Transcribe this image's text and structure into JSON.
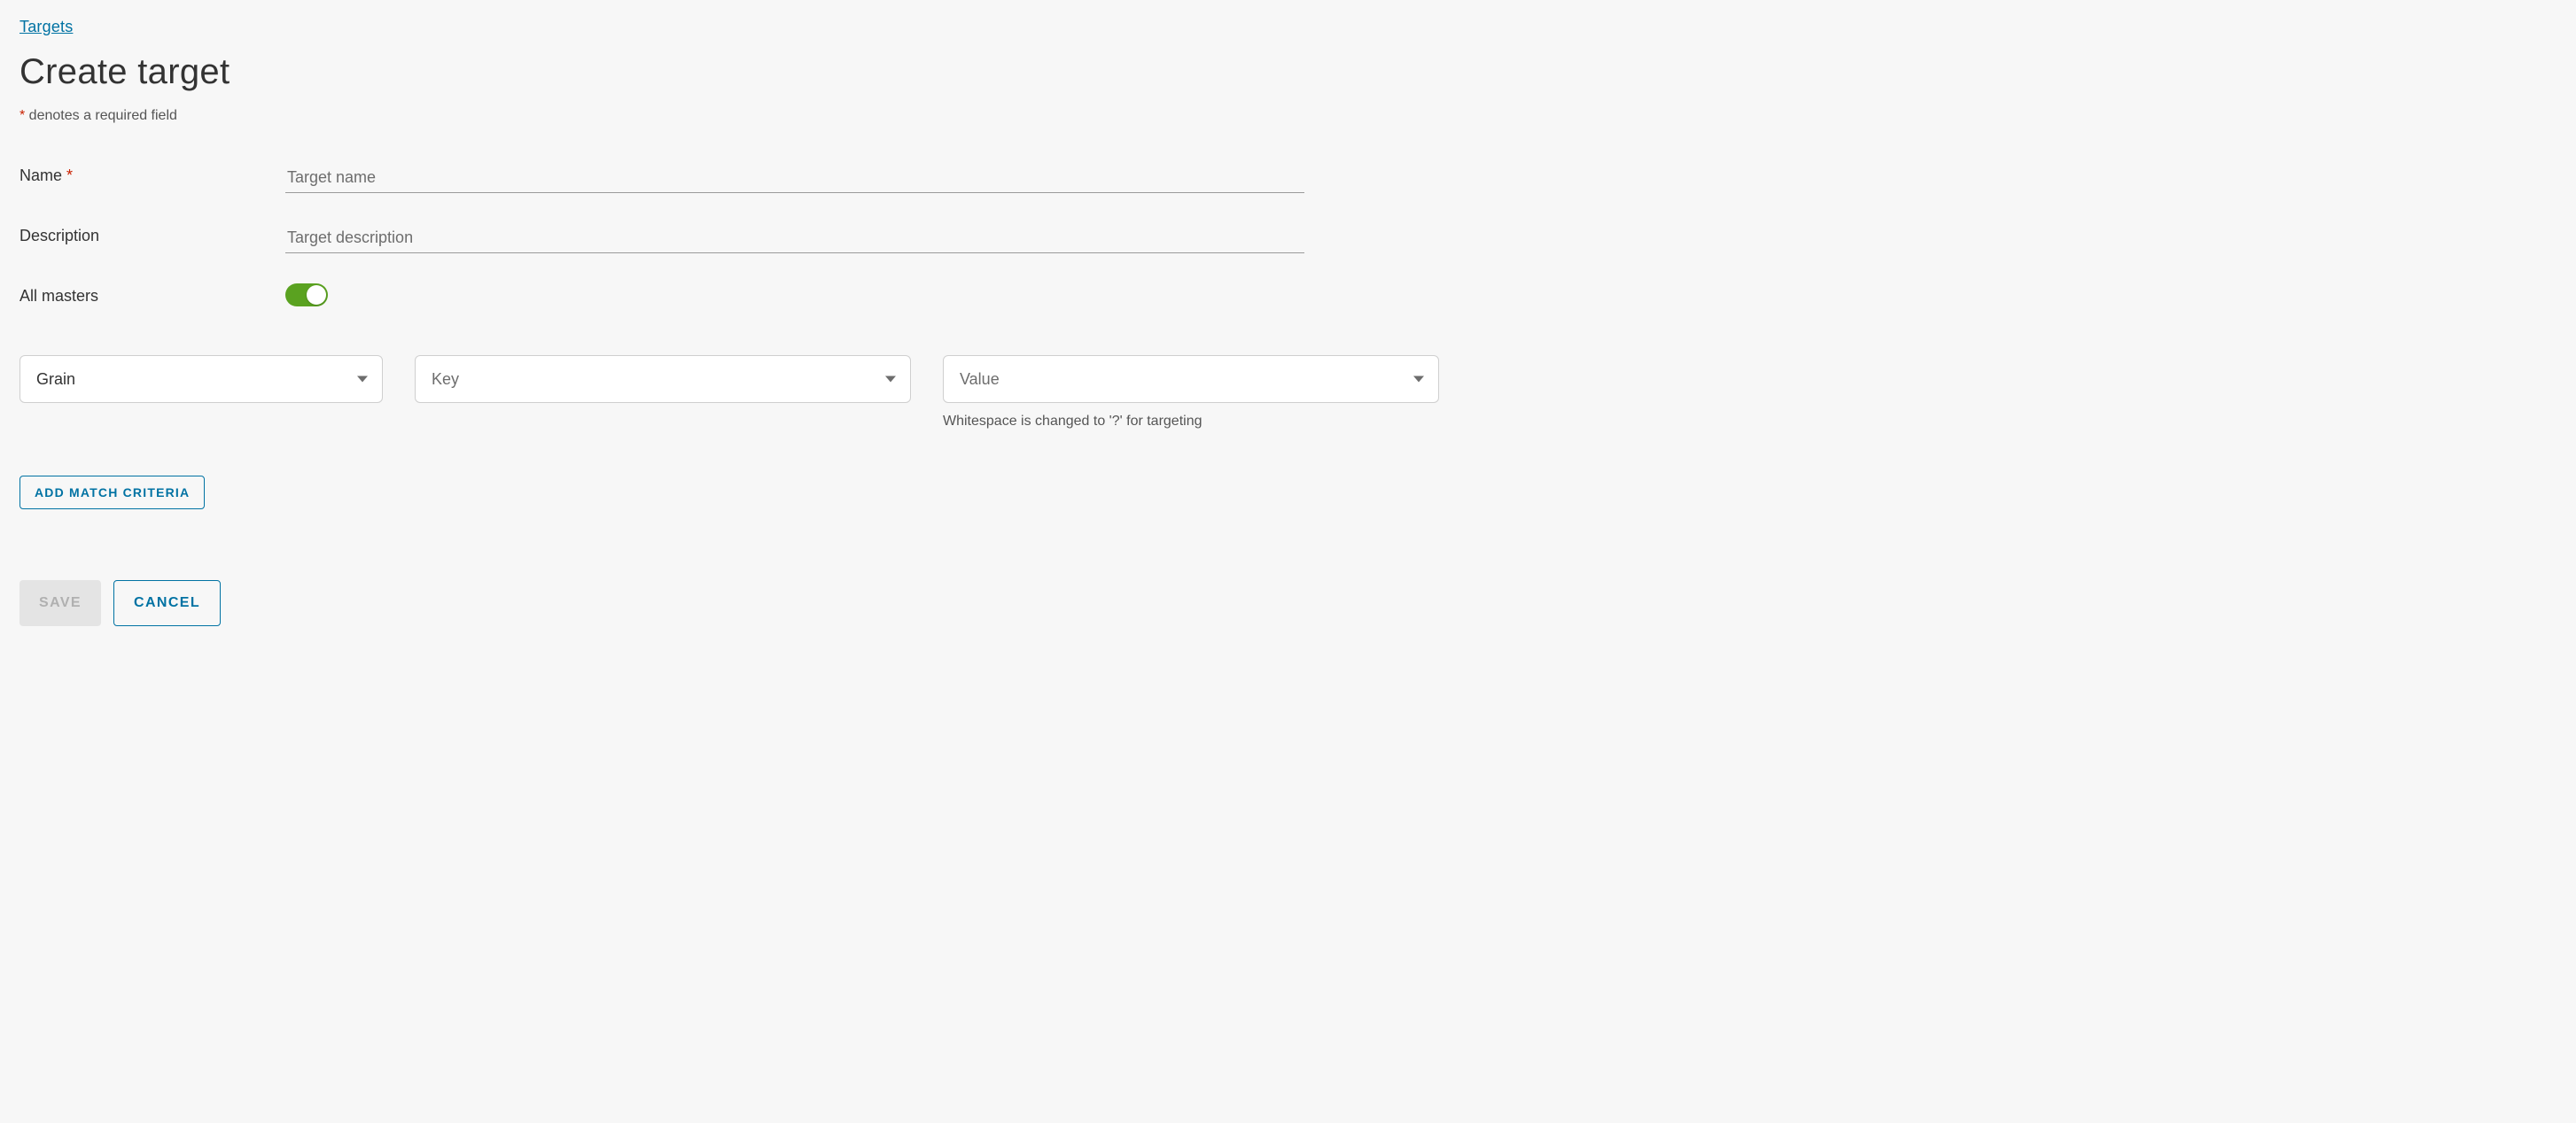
{
  "breadcrumb": {
    "targets_link": "Targets"
  },
  "page": {
    "title": "Create target",
    "required_note": " denotes a required field",
    "required_star": "*"
  },
  "form": {
    "name": {
      "label": "Name ",
      "required_mark": "*",
      "placeholder": "Target name",
      "value": ""
    },
    "description": {
      "label": "Description",
      "placeholder": "Target description",
      "value": ""
    },
    "all_masters": {
      "label": "All masters",
      "enabled": true
    }
  },
  "criteria": {
    "type": {
      "selected": "Grain",
      "is_placeholder": false
    },
    "key": {
      "selected": "Key",
      "is_placeholder": true
    },
    "value": {
      "selected": "Value",
      "is_placeholder": true,
      "helper": "Whitespace is changed to '?' for targeting"
    }
  },
  "buttons": {
    "add_match_criteria": "ADD MATCH CRITERIA",
    "save": "SAVE",
    "cancel": "CANCEL"
  }
}
